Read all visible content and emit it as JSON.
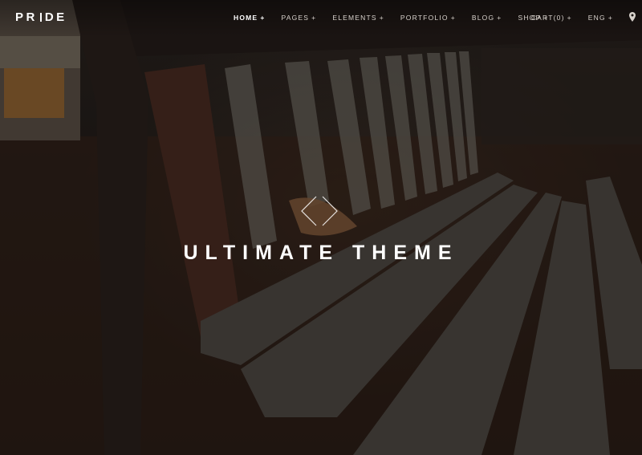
{
  "brand": {
    "logo_start": "PR",
    "logo_end": "DE"
  },
  "nav": {
    "items": [
      {
        "label": "HOME",
        "active": true
      },
      {
        "label": "PAGES",
        "active": false
      },
      {
        "label": "ELEMENTS",
        "active": false
      },
      {
        "label": "PORTFOLIO",
        "active": false
      },
      {
        "label": "BLOG",
        "active": false
      },
      {
        "label": "SHOP",
        "active": false
      }
    ],
    "cart_label": "CART(0)",
    "language_label": "ENG",
    "plus_symbol": "+",
    "location_icon": "map-pin-icon"
  },
  "hero": {
    "title": "ULTIMATE THEME",
    "prev_icon": "chevron-left-icon",
    "next_icon": "chevron-right-icon"
  },
  "colors": {
    "background": "#1a1512",
    "text": "#ffffff",
    "nav_text": "#d8d2cc"
  }
}
